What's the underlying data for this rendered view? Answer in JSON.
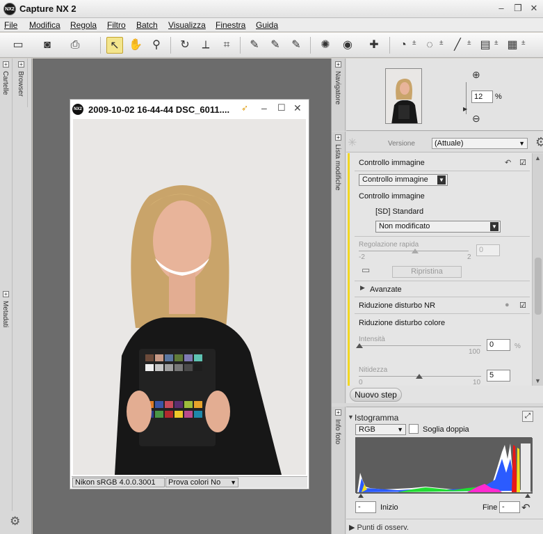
{
  "app": {
    "title": "Capture NX 2",
    "logo_text": "NX2"
  },
  "window_controls": {
    "minimize": "–",
    "restore": "❐",
    "close": "✕"
  },
  "menu": [
    "File",
    "Modifica",
    "Regola",
    "Filtro",
    "Batch",
    "Visualizza",
    "Finestra",
    "Guida"
  ],
  "toolbar": {
    "icons": [
      "browser-toggle-icon",
      "camera-icon",
      "output-icon",
      "pointer-icon",
      "hand-icon",
      "zoom-icon",
      "rotate-icon",
      "straighten-icon",
      "crop-icon",
      "black-point-icon",
      "neutral-point-icon",
      "white-point-icon",
      "red-eye-icon",
      "view-icon",
      "bandage-icon",
      "color-control-point-icon",
      "selection-lasso-icon",
      "brush-icon",
      "gradient-icon",
      "fill-icon"
    ]
  },
  "left_tabs": {
    "cartelle": "Cartelle",
    "browser": "Browser",
    "metadati": "Metadati"
  },
  "image_window": {
    "title": "2009-10-02  16-44-44  DSC_6011....",
    "status_profile": "Nikon sRGB 4.0.0.3001",
    "status_proof": "Prova colori No"
  },
  "navigator": {
    "tab_label": "Navigatore",
    "zoom_value": "12",
    "zoom_unit": "%"
  },
  "edit_list": {
    "tab_label": "Lista modifiche",
    "version_label": "Versione",
    "version_value": "(Attuale)",
    "step1": {
      "title": "Controllo immagine",
      "combo": "Controllo immagine",
      "sub_label": "Controllo immagine",
      "preset": "[SD] Standard",
      "preset_value": "Non modificato",
      "quick_label": "Regolazione rapida",
      "quick_min": "-2",
      "quick_max": "2",
      "quick_value": "0",
      "reset_label": "Ripristina",
      "advanced_label": "Avanzate"
    },
    "step2": {
      "title": "Riduzione disturbo NR",
      "sub_label": "Riduzione disturbo colore",
      "intensity_label": "Intensità",
      "intensity_max": "100",
      "intensity_value": "0",
      "intensity_unit": "%",
      "sharp_label": "Nitidezza",
      "sharp_min": "0",
      "sharp_max": "10",
      "sharp_value": "5"
    },
    "new_step_label": "Nuovo step"
  },
  "histogram": {
    "tab_label": "Info foto",
    "title": "Istogramma",
    "channel": "RGB",
    "dual_threshold": "Soglia doppia",
    "start_value": "-",
    "start_label": "Inizio",
    "end_label": "Fine",
    "end_value": "-",
    "watch_points": "Punti di osserv."
  }
}
